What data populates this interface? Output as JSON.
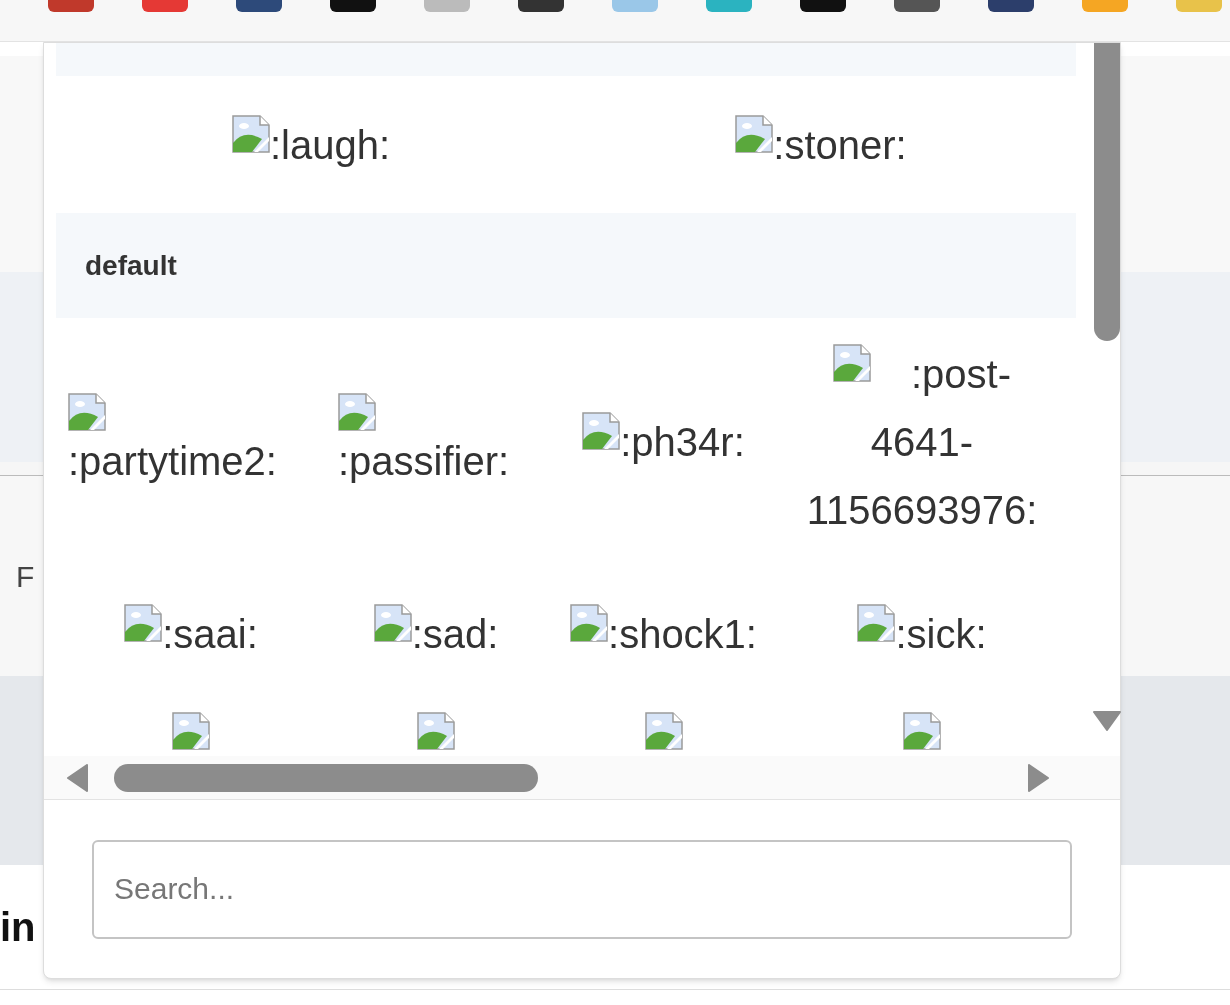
{
  "background_page": {
    "texts": [
      {
        "kind": "plain",
        "text": "F"
      },
      {
        "kind": "bold",
        "text": "in"
      }
    ]
  },
  "emoji_picker": {
    "sections": [
      {
        "items": [
          {
            "label": ":laugh:"
          },
          {
            "label": ":stoner:"
          }
        ]
      },
      {
        "heading": "default",
        "items": [
          {
            "label": ":partytime2:",
            "kind": "stacked"
          },
          {
            "label": ":passifier:",
            "kind": "stacked"
          },
          {
            "label": ":ph34r:",
            "kind": "inline"
          },
          {
            "label": ":post-4641-1156693976:",
            "kind": "wrapped"
          },
          {
            "label": ":saai:",
            "kind": "inline"
          },
          {
            "label": ":sad:",
            "kind": "inline"
          },
          {
            "label": ":shock1:",
            "kind": "inline"
          },
          {
            "label": ":sick:",
            "kind": "inline"
          },
          {
            "kind": "clipped"
          },
          {
            "kind": "clipped"
          },
          {
            "kind": "clipped"
          },
          {
            "kind": "clipped"
          }
        ]
      }
    ],
    "search": {
      "placeholder": "Search..."
    }
  }
}
